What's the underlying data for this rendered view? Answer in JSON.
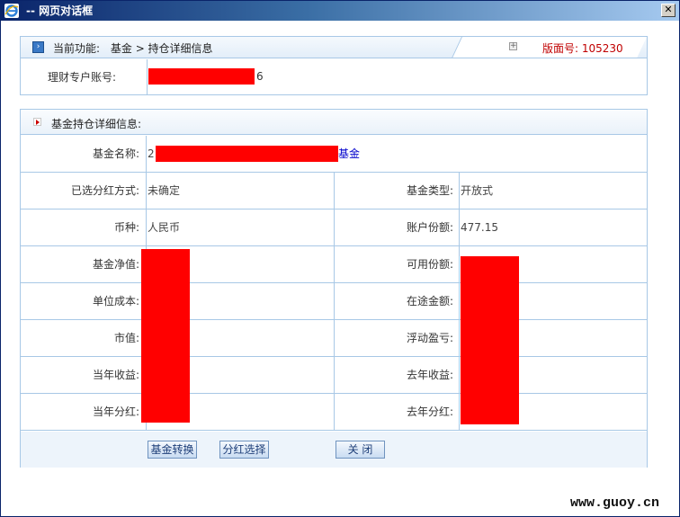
{
  "window": {
    "title": "-- 网页对话框",
    "close_label": "✕"
  },
  "header": {
    "current_label": "当前功能:",
    "current_path": "基金 > 持仓详细信息",
    "version_label": "版面号:",
    "version_value": "105230"
  },
  "account": {
    "label": "理财专户账号:",
    "value_suffix": "6"
  },
  "section": {
    "title": "基金持仓详细信息:"
  },
  "fund": {
    "name_label": "基金名称:",
    "name_prefix": "2",
    "name_suffix": "基金"
  },
  "rows": [
    {
      "left_label": "已选分红方式:",
      "left_value": "未确定",
      "right_label": "基金类型:",
      "right_value": "开放式"
    },
    {
      "left_label": "币种:",
      "left_value": "人民币",
      "right_label": "账户份额:",
      "right_value": "477.15"
    },
    {
      "left_label": "基金净值:",
      "left_value": "",
      "right_label": "可用份额:",
      "right_value": ""
    },
    {
      "left_label": "单位成本:",
      "left_value": "",
      "right_label": "在途金额:",
      "right_value": ""
    },
    {
      "left_label": "市值:",
      "left_value": "",
      "right_label": "浮动盈亏:",
      "right_value": ""
    },
    {
      "left_label": "当年收益:",
      "left_value": "",
      "right_label": "去年收益:",
      "right_value": ""
    },
    {
      "left_label": "当年分红:",
      "left_value": "",
      "right_label": "去年分红:",
      "right_value": ""
    }
  ],
  "buttons": {
    "convert": "基金转换",
    "dividend": "分红选择",
    "close": "关 闭"
  },
  "watermark": "www.guoy.cn",
  "colors": {
    "title_bar": "#0a246a",
    "border": "#a8c8e6",
    "version": "#c00000",
    "redaction": "#ff0000"
  }
}
